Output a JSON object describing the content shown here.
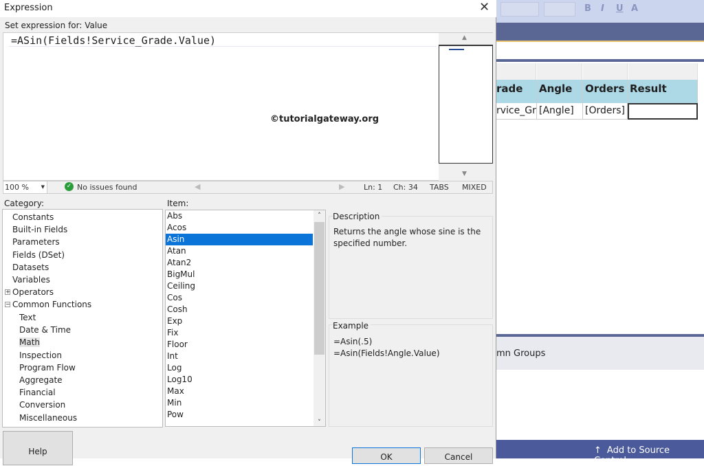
{
  "dialog": {
    "title": "Expression",
    "set_for_label": "Set expression for: Value",
    "expression": "=ASin(Fields!Service_Grade.Value)",
    "watermark": "©tutorialgateway.org",
    "status": {
      "zoom": "100 %",
      "issues": "No issues found",
      "line": "Ln: 1",
      "col": "Ch: 34",
      "tabs": "TABS",
      "eol": "MIXED"
    },
    "category_label": "Category:",
    "item_label": "Item:",
    "categories": [
      "Constants",
      "Built-in Fields",
      "Parameters",
      "Fields (DSet)",
      "Datasets",
      "Variables",
      "Operators",
      "Common Functions"
    ],
    "subcategories": [
      "Text",
      "Date & Time",
      "Math",
      "Inspection",
      "Program Flow",
      "Aggregate",
      "Financial",
      "Conversion",
      "Miscellaneous"
    ],
    "items": [
      "Abs",
      "Acos",
      "Asin",
      "Atan",
      "Atan2",
      "BigMul",
      "Ceiling",
      "Cos",
      "Cosh",
      "Exp",
      "Fix",
      "Floor",
      "Int",
      "Log",
      "Log10",
      "Max",
      "Min",
      "Pow"
    ],
    "selected_item": "Asin",
    "selected_category": "Math",
    "description_label": "Description",
    "description": "Returns the angle whose sine is the specified number.",
    "example_label": "Example",
    "examples": [
      "=Asin(.5)",
      "=Asin(Fields!Angle.Value)"
    ],
    "help": "Help",
    "ok": "OK",
    "cancel": "Cancel"
  },
  "background": {
    "headers": [
      "rade",
      "Angle",
      "Orders",
      "Result"
    ],
    "cells": [
      "rvice_Gr",
      "[Angle]",
      "[Orders]",
      ""
    ],
    "groups": "mn Groups",
    "source_control": "Add to Source Control",
    "toolbar": {
      "bold": "B",
      "italic": "I",
      "underline": "U",
      "color": "A"
    }
  },
  "colors": {
    "selection": "#0b74d8",
    "header": "#add8e6",
    "band": "#5a6794"
  }
}
